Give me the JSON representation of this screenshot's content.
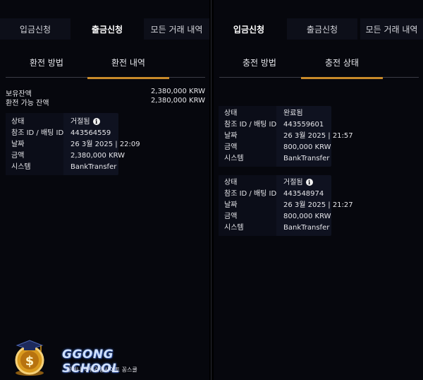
{
  "top_tabs": [
    "입금신청",
    "출금신청",
    "모든 거래 내역"
  ],
  "left": {
    "active_top_tab": 1,
    "sub_tabs": [
      "환전 방법",
      "환전 내역"
    ],
    "active_sub_tab": 1,
    "balance": [
      {
        "label": "보유잔액",
        "value": "2,380,000 KRW"
      },
      {
        "label": "환전 가능 잔액",
        "value": "2,380,000 KRW"
      }
    ],
    "card": {
      "rows": [
        {
          "label": "상태",
          "value": "거절됨",
          "info_icon": true
        },
        {
          "label": "참조 ID / 배팅 ID",
          "value": "443564559"
        },
        {
          "label": "날짜",
          "value": "26 3월 2025 | 22:09"
        },
        {
          "label": "금액",
          "value": "2,380,000 KRW"
        },
        {
          "label": "시스템",
          "value": "BankTransfer"
        }
      ]
    }
  },
  "right": {
    "active_top_tab": 0,
    "sub_tabs": [
      "충전 방법",
      "충전 상태"
    ],
    "active_sub_tab": 1,
    "cards": [
      {
        "rows": [
          {
            "label": "상태",
            "value": "완료됨"
          },
          {
            "label": "참조 ID / 배팅 ID",
            "value": "443559601"
          },
          {
            "label": "날짜",
            "value": "26 3월 2025 | 21:57"
          },
          {
            "label": "금액",
            "value": "800,000 KRW"
          },
          {
            "label": "시스템",
            "value": "BankTransfer"
          }
        ]
      },
      {
        "rows": [
          {
            "label": "상태",
            "value": "거절됨",
            "info_icon": true
          },
          {
            "label": "참조 ID / 배팅 ID",
            "value": "443548974"
          },
          {
            "label": "날짜",
            "value": "26 3월 2025 | 21:27"
          },
          {
            "label": "금액",
            "value": "800,000 KRW"
          },
          {
            "label": "시스템",
            "value": "BankTransfer"
          }
        ]
      }
    ]
  },
  "watermark": {
    "title": "GGONG SCHOOL",
    "subtitle": "꽁머니   먹튀검증사이트 꽁스쿨",
    "badge_symbol": "$"
  },
  "info_icon_symbol": "i",
  "colors": {
    "accent": "#c98a2a",
    "background": "#06070d",
    "card": "#0f1220"
  }
}
